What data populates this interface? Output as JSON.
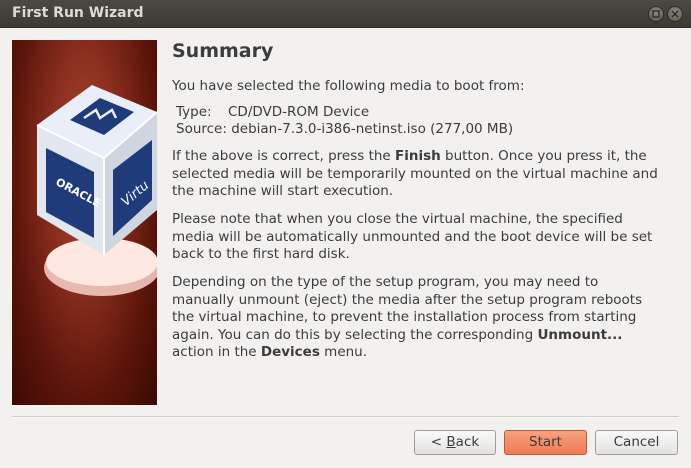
{
  "window": {
    "title": "First Run Wizard"
  },
  "summary": {
    "heading": "Summary",
    "intro": "You have selected the following media to boot from:",
    "type_label": "Type:",
    "type_value": "CD/DVD-ROM Device",
    "source_label": "Source:",
    "source_value": "debian-7.3.0-i386-netinst.iso (277,00 MB)",
    "p1_a": "If the above is correct, press the ",
    "p1_b": "Finish",
    "p1_c": " button. Once you press it, the selected media will be temporarily mounted on the virtual machine and the machine will start execution.",
    "p2": "Please note that when you close the virtual machine, the specified media will be automatically unmounted and the boot device will be set back to the first hard disk.",
    "p3_a": "Depending on the type of the setup program, you may need to manually unmount (eject) the media after the setup program reboots the virtual machine, to prevent the installation process from starting again. You can do this by selecting the corresponding ",
    "p3_b": "Unmount...",
    "p3_c": " action in the ",
    "p3_d": "Devices",
    "p3_e": " menu."
  },
  "logo": {
    "brand_left": "ORACLE",
    "brand_right": "Virtu"
  },
  "buttons": {
    "back_prefix": "< ",
    "back_underlined": "B",
    "back_rest": "ack",
    "start": "Start",
    "cancel": "Cancel"
  },
  "colors": {
    "start_button": "#ee7b54",
    "titlebar": "#3b3a35",
    "side_panel": "#8a2e1e"
  }
}
